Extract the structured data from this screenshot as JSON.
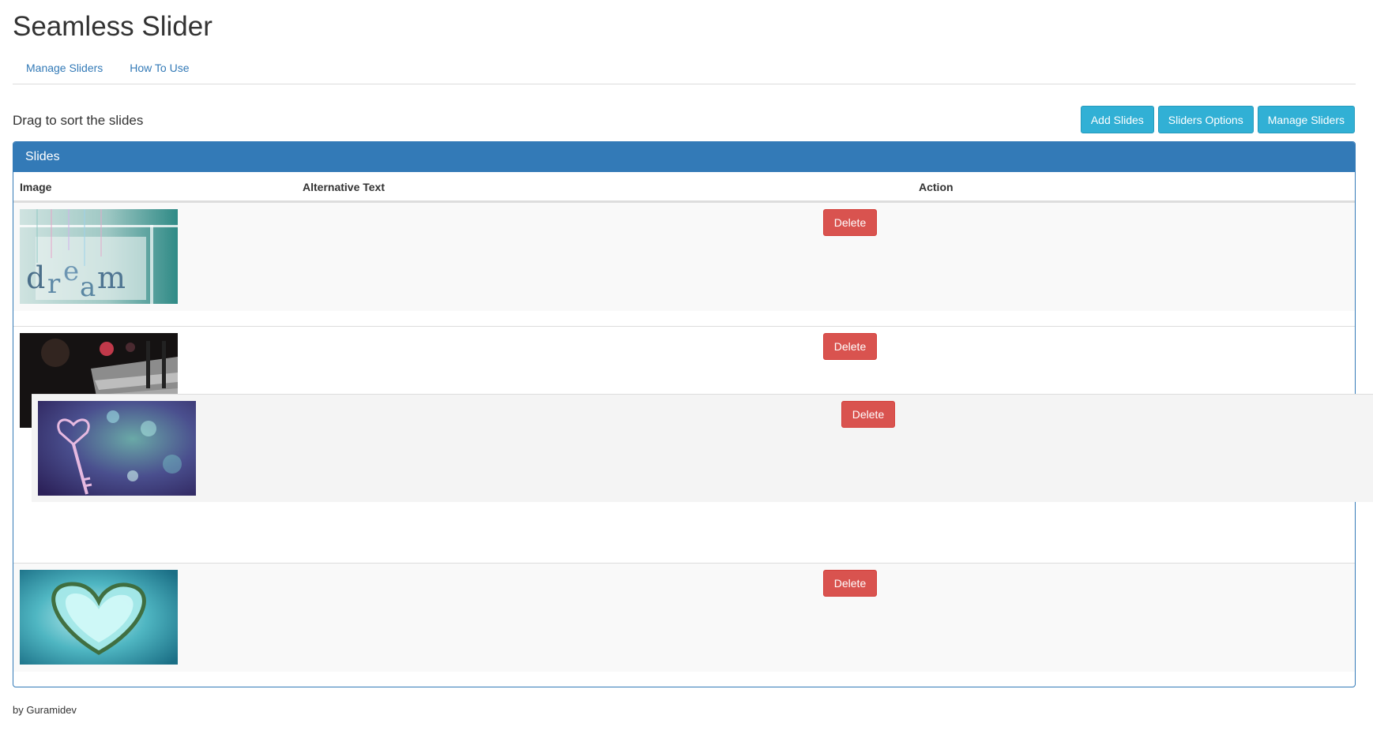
{
  "app": {
    "title": "Seamless Slider"
  },
  "nav": {
    "items": [
      "Manage Sliders",
      "How To Use"
    ]
  },
  "toolbar": {
    "hint": "Drag to sort the slides",
    "add_slides": "Add Slides",
    "sliders_options": "Sliders Options",
    "manage_sliders": "Manage Sliders"
  },
  "panel": {
    "title": "Slides",
    "columns": [
      "Image",
      "Alternative Text",
      "Action"
    ]
  },
  "slides": [
    {
      "image": "dream-letters-image",
      "alt_text": "",
      "action": "Delete"
    },
    {
      "image": "night-bench-image",
      "alt_text": "",
      "action": "Delete"
    },
    {
      "image": "heart-key-image",
      "alt_text": "",
      "action": "Delete"
    },
    {
      "image": "heart-island-image",
      "alt_text": "",
      "action": "Delete"
    }
  ],
  "footer": {
    "text": "by Guramidev"
  }
}
